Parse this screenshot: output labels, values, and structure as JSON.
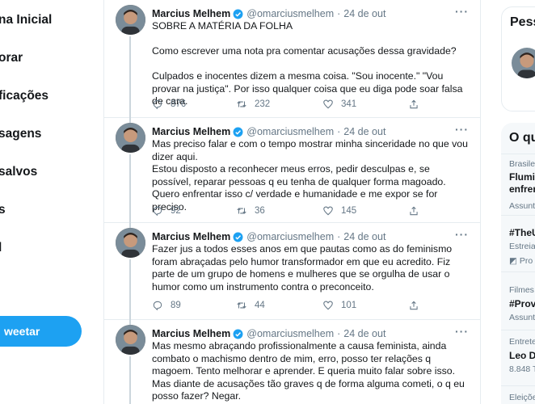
{
  "nav": {
    "items": [
      "na Inicial",
      "orar",
      "ficações",
      "sagens",
      "salvos",
      "s",
      "l"
    ],
    "tweet_button": "weetar"
  },
  "author": {
    "name": "Marcius Melhem",
    "handle": "@omarciusmelhem",
    "dot": "·"
  },
  "tweets": [
    {
      "date": "24 de out",
      "text": "SOBRE A MATÉRIA DA FOLHA\n\nComo escrever uma nota pra comentar acusações dessa gravidade?\n\nCulpados e inocentes dizem a mesma coisa. \"Sou inocente.\" \"Vou provar na justiça\". Por isso qualquer coisa que eu diga pode soar falsa de cara.",
      "replies": "876",
      "retweets": "232",
      "likes": "341"
    },
    {
      "date": "24 de out",
      "text": "Mas preciso falar e com o tempo mostrar minha sinceridade no que vou dizer aqui.\nEstou disposto a reconhecer meus erros, pedir desculpas e, se possível, reparar pessoas q eu tenha de qualquer forma magoado. Quero enfrentar isso c/ verdade e humanidade e me expor se for preciso.",
      "replies": "92",
      "retweets": "36",
      "likes": "145"
    },
    {
      "date": "24 de out",
      "text": "Fazer jus a todos esses anos em que pautas como as do feminismo foram abraçadas pelo humor transformador em que eu acredito. Fiz parte de um grupo de homens e mulheres que se orgulha de usar o humor como um instrumento contra o preconceito.",
      "replies": "89",
      "retweets": "44",
      "likes": "101"
    },
    {
      "date": "24 de out",
      "text": "Mas mesmo abraçando profissionalmente a causa feminista, ainda combato o machismo dentro de mim, erro, posso ter relações q magoem. Tento melhorar e aprender. E queria muito falar sobre isso.\nMas diante de acusações tão graves q de forma alguma cometi, o q eu posso fazer? Negar.",
      "replies": "",
      "retweets": "",
      "likes": ""
    }
  ],
  "right": {
    "card1_title": "Pess",
    "card2_title": "O qu",
    "trends": [
      {
        "ctx": "Brasilei",
        "title": "Flumi\nenfren",
        "meta": "Assunt"
      },
      {
        "ctx": "",
        "title": "#TheU",
        "meta": "Estreia",
        "promo": "Pro"
      },
      {
        "ctx": "Filmes",
        "title": "#Prov",
        "meta": "Assunt"
      },
      {
        "ctx": "Entrete",
        "title": "Leo D",
        "meta": "8.848 T"
      },
      {
        "ctx": "Eleiçõe",
        "title": "",
        "meta": ""
      }
    ]
  },
  "colors": {
    "accent": "#1da1f2",
    "muted": "#657786",
    "border": "#e6ecf0"
  }
}
